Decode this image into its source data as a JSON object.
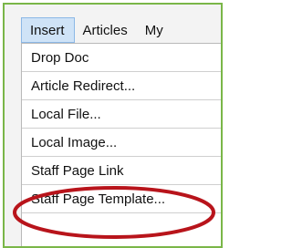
{
  "menubar": {
    "items": [
      {
        "label": "Insert",
        "active": true
      },
      {
        "label": "Articles",
        "active": false
      },
      {
        "label": "My",
        "active": false
      }
    ]
  },
  "dropdown": {
    "items": [
      {
        "label": "Drop Doc"
      },
      {
        "label": "Article Redirect..."
      },
      {
        "label": "Local File..."
      },
      {
        "label": "Local Image..."
      },
      {
        "label": "Staff Page Link"
      },
      {
        "label": "Staff Page Template..."
      }
    ]
  },
  "colors": {
    "frame_border": "#7ab648",
    "active_menu_bg": "#cfe3f7",
    "annotation_ellipse": "#b8141b"
  }
}
